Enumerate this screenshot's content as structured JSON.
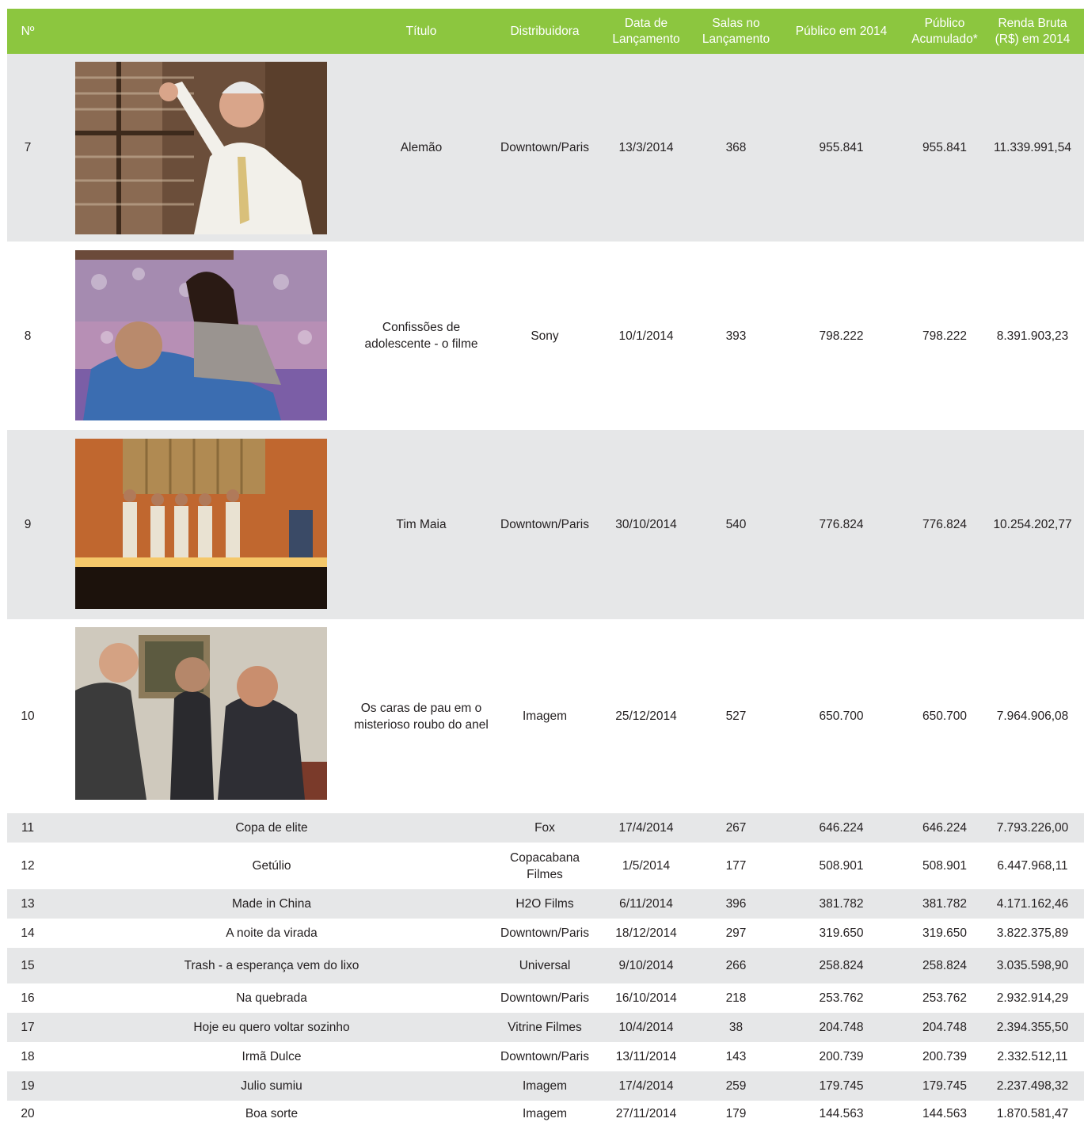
{
  "header": {
    "no": "Nº",
    "title": "Título",
    "distributor": "Distribuidora",
    "release_date_l1": "Data de",
    "release_date_l2": "Lançamento",
    "rooms_l1": "Salas no",
    "rooms_l2": "Lançamento",
    "audience_2014": "Público em 2014",
    "accumulated_l1": "Público",
    "accumulated_l2": "Acumulado*",
    "revenue_l1": "Renda Bruta",
    "revenue_l2": "(R$) em 2014"
  },
  "films": [
    {
      "no": "7",
      "title": "Alemão",
      "distributor": "Downtown/Paris",
      "date": "13/3/2014",
      "rooms": "368",
      "audience": "955.841",
      "accumulated": "955.841",
      "revenue": "11.339.991,54"
    },
    {
      "no": "8",
      "title": "Confissões de adolescente - o filme",
      "distributor": "Sony",
      "date": "10/1/2014",
      "rooms": "393",
      "audience": "798.222",
      "accumulated": "798.222",
      "revenue": "8.391.903,23"
    },
    {
      "no": "9",
      "title": "Tim Maia",
      "distributor": "Downtown/Paris",
      "date": "30/10/2014",
      "rooms": "540",
      "audience": "776.824",
      "accumulated": "776.824",
      "revenue": "10.254.202,77"
    },
    {
      "no": "10",
      "title": "Os caras de pau em o misterioso roubo do anel",
      "distributor": "Imagem",
      "date": "25/12/2014",
      "rooms": "527",
      "audience": "650.700",
      "accumulated": "650.700",
      "revenue": "7.964.906,08"
    },
    {
      "no": "11",
      "title": "Copa de elite",
      "distributor": "Fox",
      "date": "17/4/2014",
      "rooms": "267",
      "audience": "646.224",
      "accumulated": "646.224",
      "revenue": "7.793.226,00"
    },
    {
      "no": "12",
      "title": "Getúlio",
      "distributor": "Copacabana Filmes",
      "date": "1/5/2014",
      "rooms": "177",
      "audience": "508.901",
      "accumulated": "508.901",
      "revenue": "6.447.968,11"
    },
    {
      "no": "13",
      "title": "Made in China",
      "distributor": "H2O Films",
      "date": "6/11/2014",
      "rooms": "396",
      "audience": "381.782",
      "accumulated": "381.782",
      "revenue": "4.171.162,46"
    },
    {
      "no": "14",
      "title": "A noite da virada",
      "distributor": "Downtown/Paris",
      "date": "18/12/2014",
      "rooms": "297",
      "audience": "319.650",
      "accumulated": "319.650",
      "revenue": "3.822.375,89"
    },
    {
      "no": "15",
      "title": "Trash - a esperança vem do lixo",
      "distributor": "Universal",
      "date": "9/10/2014",
      "rooms": "266",
      "audience": "258.824",
      "accumulated": "258.824",
      "revenue": "3.035.598,90"
    },
    {
      "no": "16",
      "title": "Na quebrada",
      "distributor": "Downtown/Paris",
      "date": "16/10/2014",
      "rooms": "218",
      "audience": "253.762",
      "accumulated": "253.762",
      "revenue": "2.932.914,29"
    },
    {
      "no": "17",
      "title": "Hoje eu quero voltar sozinho",
      "distributor": "Vitrine Filmes",
      "date": "10/4/2014",
      "rooms": "38",
      "audience": "204.748",
      "accumulated": "204.748",
      "revenue": "2.394.355,50"
    },
    {
      "no": "18",
      "title": "Irmã Dulce",
      "distributor": "Downtown/Paris",
      "date": "13/11/2014",
      "rooms": "143",
      "audience": "200.739",
      "accumulated": "200.739",
      "revenue": "2.332.512,11"
    },
    {
      "no": "19",
      "title": "Julio sumiu",
      "distributor": "Imagem",
      "date": "17/4/2014",
      "rooms": "259",
      "audience": "179.745",
      "accumulated": "179.745",
      "revenue": "2.237.498,32"
    },
    {
      "no": "20",
      "title": "Boa sorte",
      "distributor": "Imagem",
      "date": "27/11/2014",
      "rooms": "179",
      "audience": "144.563",
      "accumulated": "144.563",
      "revenue": "1.870.581,47"
    }
  ],
  "colors": {
    "header_bg": "#8cc63f",
    "header_text": "#ffffff",
    "row_alt": "#e6e7e8"
  }
}
